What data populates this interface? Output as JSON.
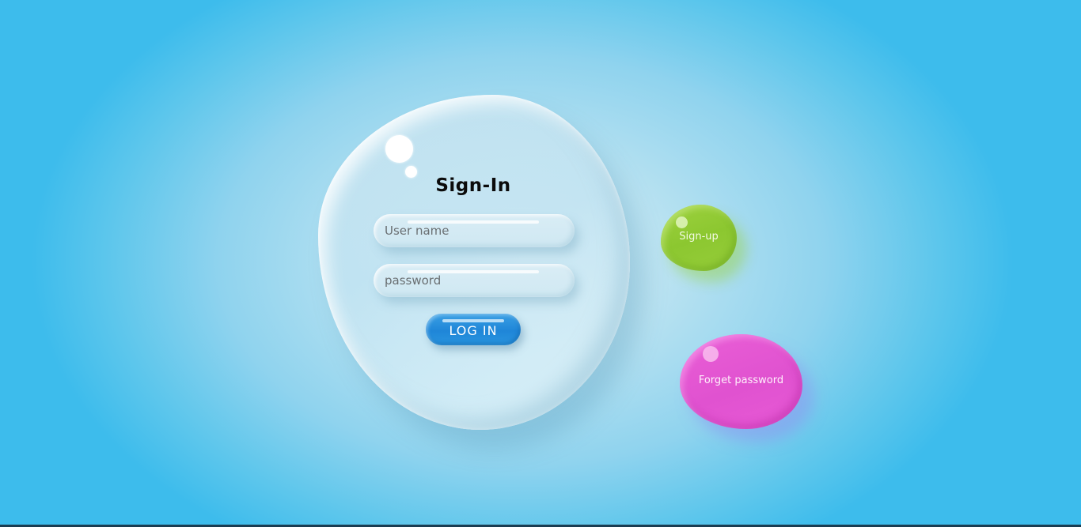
{
  "login_card": {
    "title": "Sign-In",
    "username_placeholder": "User name",
    "password_placeholder": "password",
    "login_button": "LOG IN"
  },
  "side_actions": {
    "signup_label": "Sign-up",
    "forget_password_label": "Forget password"
  },
  "colors": {
    "background": "#5cc6ec",
    "login_button": "#1f86d8",
    "signup_blob": "#8cc730",
    "forget_blob": "#e052d0"
  }
}
